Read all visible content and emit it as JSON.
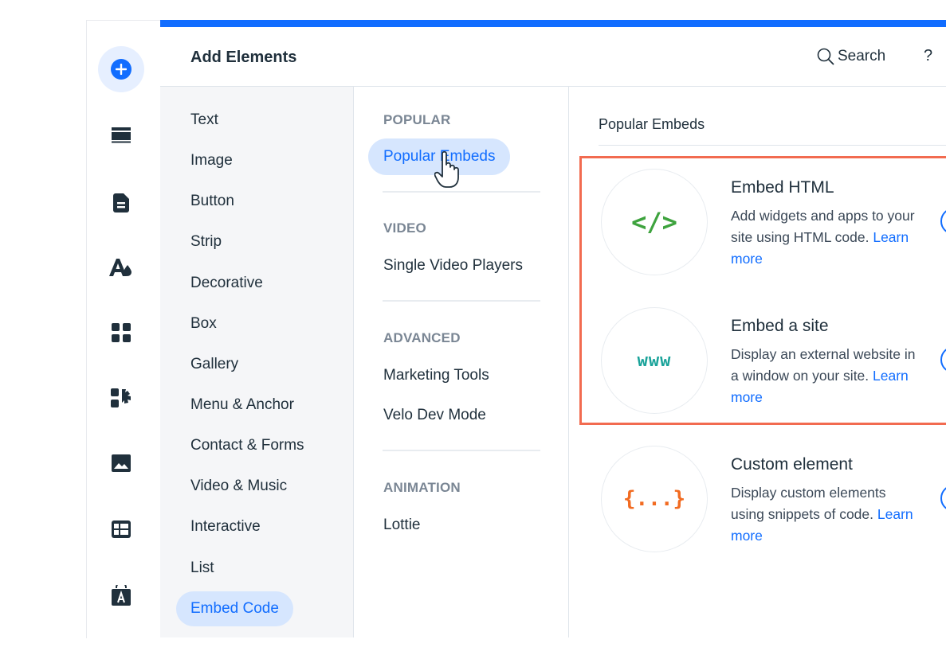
{
  "header": {
    "title": "Add Elements",
    "search_label": "Search",
    "help_label": "?"
  },
  "left_rail": [
    {
      "icon": "add-icon",
      "active": true
    },
    {
      "icon": "section-icon"
    },
    {
      "icon": "page-icon"
    },
    {
      "icon": "theme-icon"
    },
    {
      "icon": "apps-icon"
    },
    {
      "icon": "app-market-icon"
    },
    {
      "icon": "media-icon"
    },
    {
      "icon": "cms-icon"
    },
    {
      "icon": "business-icon"
    }
  ],
  "categories": [
    {
      "label": "Text"
    },
    {
      "label": "Image"
    },
    {
      "label": "Button"
    },
    {
      "label": "Strip"
    },
    {
      "label": "Decorative"
    },
    {
      "label": "Box"
    },
    {
      "label": "Gallery"
    },
    {
      "label": "Menu & Anchor"
    },
    {
      "label": "Contact & Forms"
    },
    {
      "label": "Video & Music"
    },
    {
      "label": "Interactive"
    },
    {
      "label": "List"
    },
    {
      "label": "Embed Code",
      "active": true
    }
  ],
  "subcategories": {
    "popular": {
      "title": "POPULAR",
      "items": [
        {
          "label": "Popular Embeds",
          "active": true
        }
      ]
    },
    "video": {
      "title": "VIDEO",
      "items": [
        {
          "label": "Single Video Players"
        }
      ]
    },
    "advanced": {
      "title": "ADVANCED",
      "items": [
        {
          "label": "Marketing Tools"
        },
        {
          "label": "Velo Dev Mode"
        }
      ]
    },
    "animation": {
      "title": "ANIMATION",
      "items": [
        {
          "label": "Lottie"
        }
      ]
    }
  },
  "main": {
    "section_title": "Popular Embeds",
    "cards": [
      {
        "icon_text": "</>",
        "icon_color": "#3ea33e",
        "title": "Embed HTML",
        "description": "Add widgets and apps to your site using HTML code.",
        "link": "Learn more"
      },
      {
        "icon_text": "www",
        "icon_color": "#1aa39a",
        "title": "Embed a site",
        "description": "Display an external website in a window on your site.",
        "link": "Learn more"
      },
      {
        "icon_text": "{...}",
        "icon_color": "#f26b21",
        "title": "Custom element",
        "description": "Display custom elements using snippets of code.",
        "link": "Learn more"
      }
    ]
  },
  "colors": {
    "accent": "#116dff",
    "highlight_border": "#f26b50",
    "selected_bg": "#d6e6fe"
  }
}
